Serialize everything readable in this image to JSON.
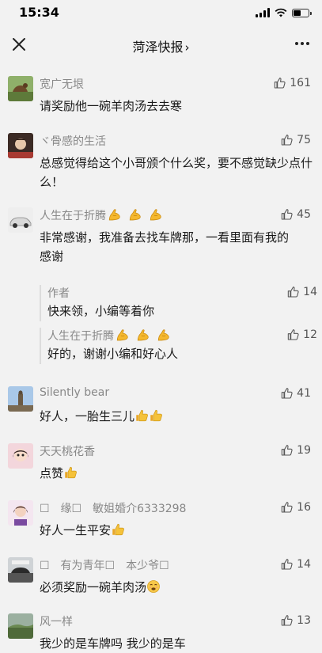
{
  "status_bar": {
    "time": "15:34"
  },
  "header": {
    "title": "菏泽快报",
    "chevron": "›"
  },
  "colors": {
    "background": "#f2f2f2",
    "name_text": "#888888",
    "body_text": "#1a1a1a",
    "reply_bar": "#dcdcdc"
  },
  "comments": [
    {
      "name": "宽广无垠",
      "likes": "161",
      "text": "请奖励他一碗羊肉汤去去寒"
    },
    {
      "name": "ヾ骨感的生活",
      "likes": "75",
      "text": "总感觉得给这个小哥颁个什么奖，要不感觉缺少点什么！"
    },
    {
      "name": "人生在于折腾",
      "likes": "45",
      "text_line1": "非常感谢，我准备去找车牌那，一看里面有我的",
      "text_line2": "感谢",
      "replies": [
        {
          "name": "作者",
          "likes": "14",
          "text": "快来领，小编等着你"
        },
        {
          "name": "人生在于折腾",
          "likes": "12",
          "text": "好的，谢谢小编和好心人"
        }
      ]
    },
    {
      "name": "Silently bear",
      "likes": "41",
      "text": "好人，一胎生三儿"
    },
    {
      "name": "天天桃花香",
      "likes": "19",
      "text": "点赞"
    },
    {
      "name": "☐　缘☐　敏姐婚介6333298",
      "likes": "16",
      "text": "好人一生平安"
    },
    {
      "name": "☐　有为青年☐　本少爷☐",
      "likes": "14",
      "text": "必须奖励一碗羊肉汤"
    },
    {
      "name": "风一样",
      "likes": "13",
      "text": "我少的是车牌吗 我少的是车"
    }
  ]
}
